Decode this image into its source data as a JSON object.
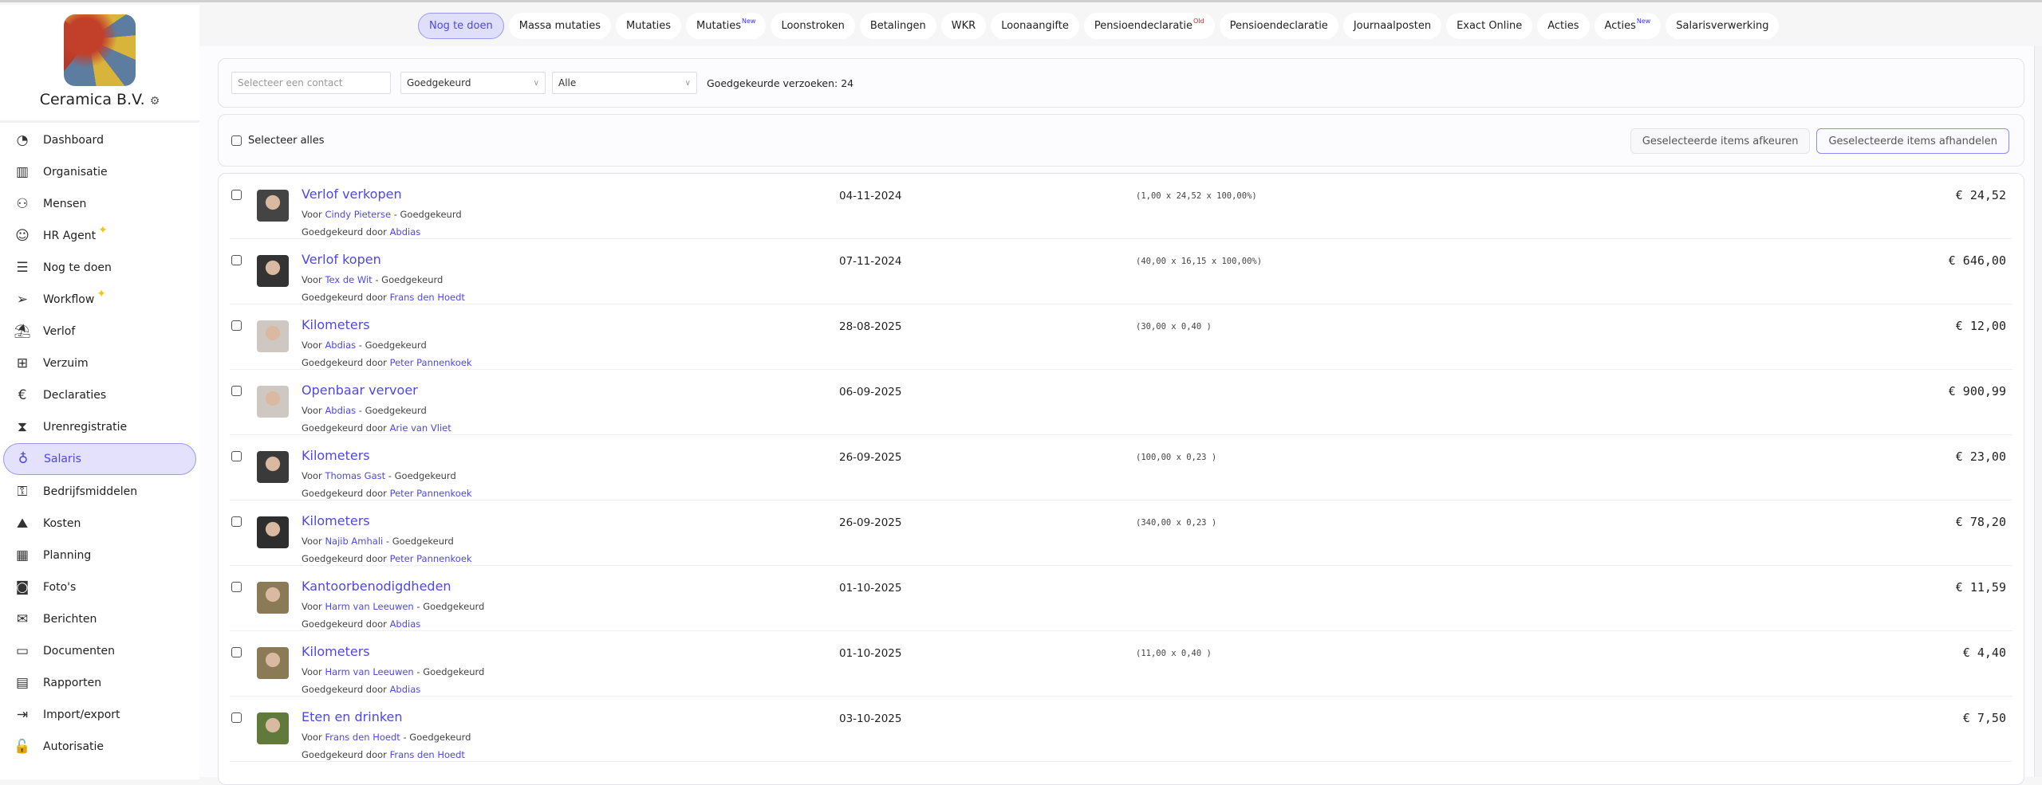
{
  "company": {
    "name": "Ceramica B.V."
  },
  "sidebar": {
    "items": [
      {
        "label": "Dashboard",
        "icon": "pie-chart-icon",
        "glyph": "◔"
      },
      {
        "label": "Organisatie",
        "icon": "building-icon",
        "glyph": "▥"
      },
      {
        "label": "Mensen",
        "icon": "people-icon",
        "glyph": "⚇"
      },
      {
        "label": "HR Agent",
        "icon": "agent-icon",
        "glyph": "☺",
        "sparkle": true
      },
      {
        "label": "Nog te doen",
        "icon": "checklist-icon",
        "glyph": "☰"
      },
      {
        "label": "Workflow",
        "icon": "paper-plane-icon",
        "glyph": "➢",
        "sparkle": true
      },
      {
        "label": "Verlof",
        "icon": "palm-tree-icon",
        "glyph": "⛱"
      },
      {
        "label": "Verzuim",
        "icon": "medical-kit-icon",
        "glyph": "⊞"
      },
      {
        "label": "Declaraties",
        "icon": "euro-icon",
        "glyph": "€"
      },
      {
        "label": "Urenregistratie",
        "icon": "hourglass-icon",
        "glyph": "⧗"
      },
      {
        "label": "Salaris",
        "icon": "money-bag-icon",
        "glyph": "♁",
        "active": true
      },
      {
        "label": "Bedrijfsmiddelen",
        "icon": "key-icon",
        "glyph": "⚿"
      },
      {
        "label": "Kosten",
        "icon": "area-chart-icon",
        "glyph": "⛰"
      },
      {
        "label": "Planning",
        "icon": "calendar-icon",
        "glyph": "▦"
      },
      {
        "label": "Foto's",
        "icon": "camera-icon",
        "glyph": "◙"
      },
      {
        "label": "Berichten",
        "icon": "messages-icon",
        "glyph": "✉"
      },
      {
        "label": "Documenten",
        "icon": "folder-icon",
        "glyph": "▭"
      },
      {
        "label": "Rapporten",
        "icon": "report-icon",
        "glyph": "▤"
      },
      {
        "label": "Import/export",
        "icon": "import-export-icon",
        "glyph": "⇥"
      },
      {
        "label": "Autorisatie",
        "icon": "unlock-icon",
        "glyph": "🔓"
      }
    ]
  },
  "tabs": [
    {
      "label": "Nog te doen",
      "active": true
    },
    {
      "label": "Massa mutaties"
    },
    {
      "label": "Mutaties"
    },
    {
      "label": "Mutaties",
      "badge": "New"
    },
    {
      "label": "Loonstroken"
    },
    {
      "label": "Betalingen"
    },
    {
      "label": "WKR"
    },
    {
      "label": "Loonaangifte"
    },
    {
      "label": "Pensioendeclaratie",
      "badge": "Old",
      "badge_color": "#e0201f"
    },
    {
      "label": "Pensioendeclaratie"
    },
    {
      "label": "Journaalposten"
    },
    {
      "label": "Exact Online"
    },
    {
      "label": "Acties"
    },
    {
      "label": "Acties",
      "badge": "New"
    },
    {
      "label": "Salarisverwerking"
    }
  ],
  "filters": {
    "contact_placeholder": "Selecteer een contact",
    "status": "Goedgekeurd",
    "type": "Alle",
    "count_text": "Goedgekeurde verzoeken: 24"
  },
  "selectbar": {
    "select_all": "Selecteer alles",
    "reject": "Geselecteerde items afkeuren",
    "handle": "Geselecteerde items afhandelen"
  },
  "labels": {
    "for": "Voor",
    "approved_by": "Goedgekeurd door",
    "status": "Goedgekeurd"
  },
  "rows": [
    {
      "title": "Verlof verkopen",
      "person": "Cindy Pieterse",
      "approver": "Abdias",
      "date": "04-11-2024",
      "formula": "(1,00 x 24,52 x 100,00%)",
      "amount": "€ 24,52",
      "av": "#444"
    },
    {
      "title": "Verlof kopen",
      "person": "Tex de Wit",
      "approver": "Frans den Hoedt",
      "date": "07-11-2024",
      "formula": "(40,00 x 16,15 x 100,00%)",
      "amount": "€ 646,00",
      "av": "#333"
    },
    {
      "title": "Kilometers",
      "person": "Abdias",
      "approver": "Peter Pannenkoek",
      "date": "28-08-2025",
      "formula": "(30,00 x 0,40 )",
      "amount": "€ 12,00",
      "av": "#cfc8c2"
    },
    {
      "title": "Openbaar vervoer",
      "person": "Abdias",
      "approver": "Arie van Vliet",
      "date": "06-09-2025",
      "formula": "",
      "amount": "€ 900,99",
      "av": "#cfc8c2"
    },
    {
      "title": "Kilometers",
      "person": "Thomas Gast",
      "approver": "Peter Pannenkoek",
      "date": "26-09-2025",
      "formula": "(100,00 x 0,23 )",
      "amount": "€ 23,00",
      "av": "#3a3a3a"
    },
    {
      "title": "Kilometers",
      "person": "Najib Amhali",
      "approver": "Peter Pannenkoek",
      "date": "26-09-2025",
      "formula": "(340,00 x 0,23 )",
      "amount": "€ 78,20",
      "av": "#2e2e2e"
    },
    {
      "title": "Kantoorbenodigdheden",
      "person": "Harm van Leeuwen",
      "approver": "Abdias",
      "date": "01-10-2025",
      "formula": "",
      "amount": "€ 11,59",
      "av": "#8a7a55"
    },
    {
      "title": "Kilometers",
      "person": "Harm van Leeuwen",
      "approver": "Abdias",
      "date": "01-10-2025",
      "formula": "(11,00 x 0,40 )",
      "amount": "€ 4,40",
      "av": "#8a7a55"
    },
    {
      "title": "Eten en drinken",
      "person": "Frans den Hoedt",
      "approver": "Frans den Hoedt",
      "date": "03-10-2025",
      "formula": "",
      "amount": "€ 7,50",
      "av": "#5f7a3a"
    }
  ]
}
